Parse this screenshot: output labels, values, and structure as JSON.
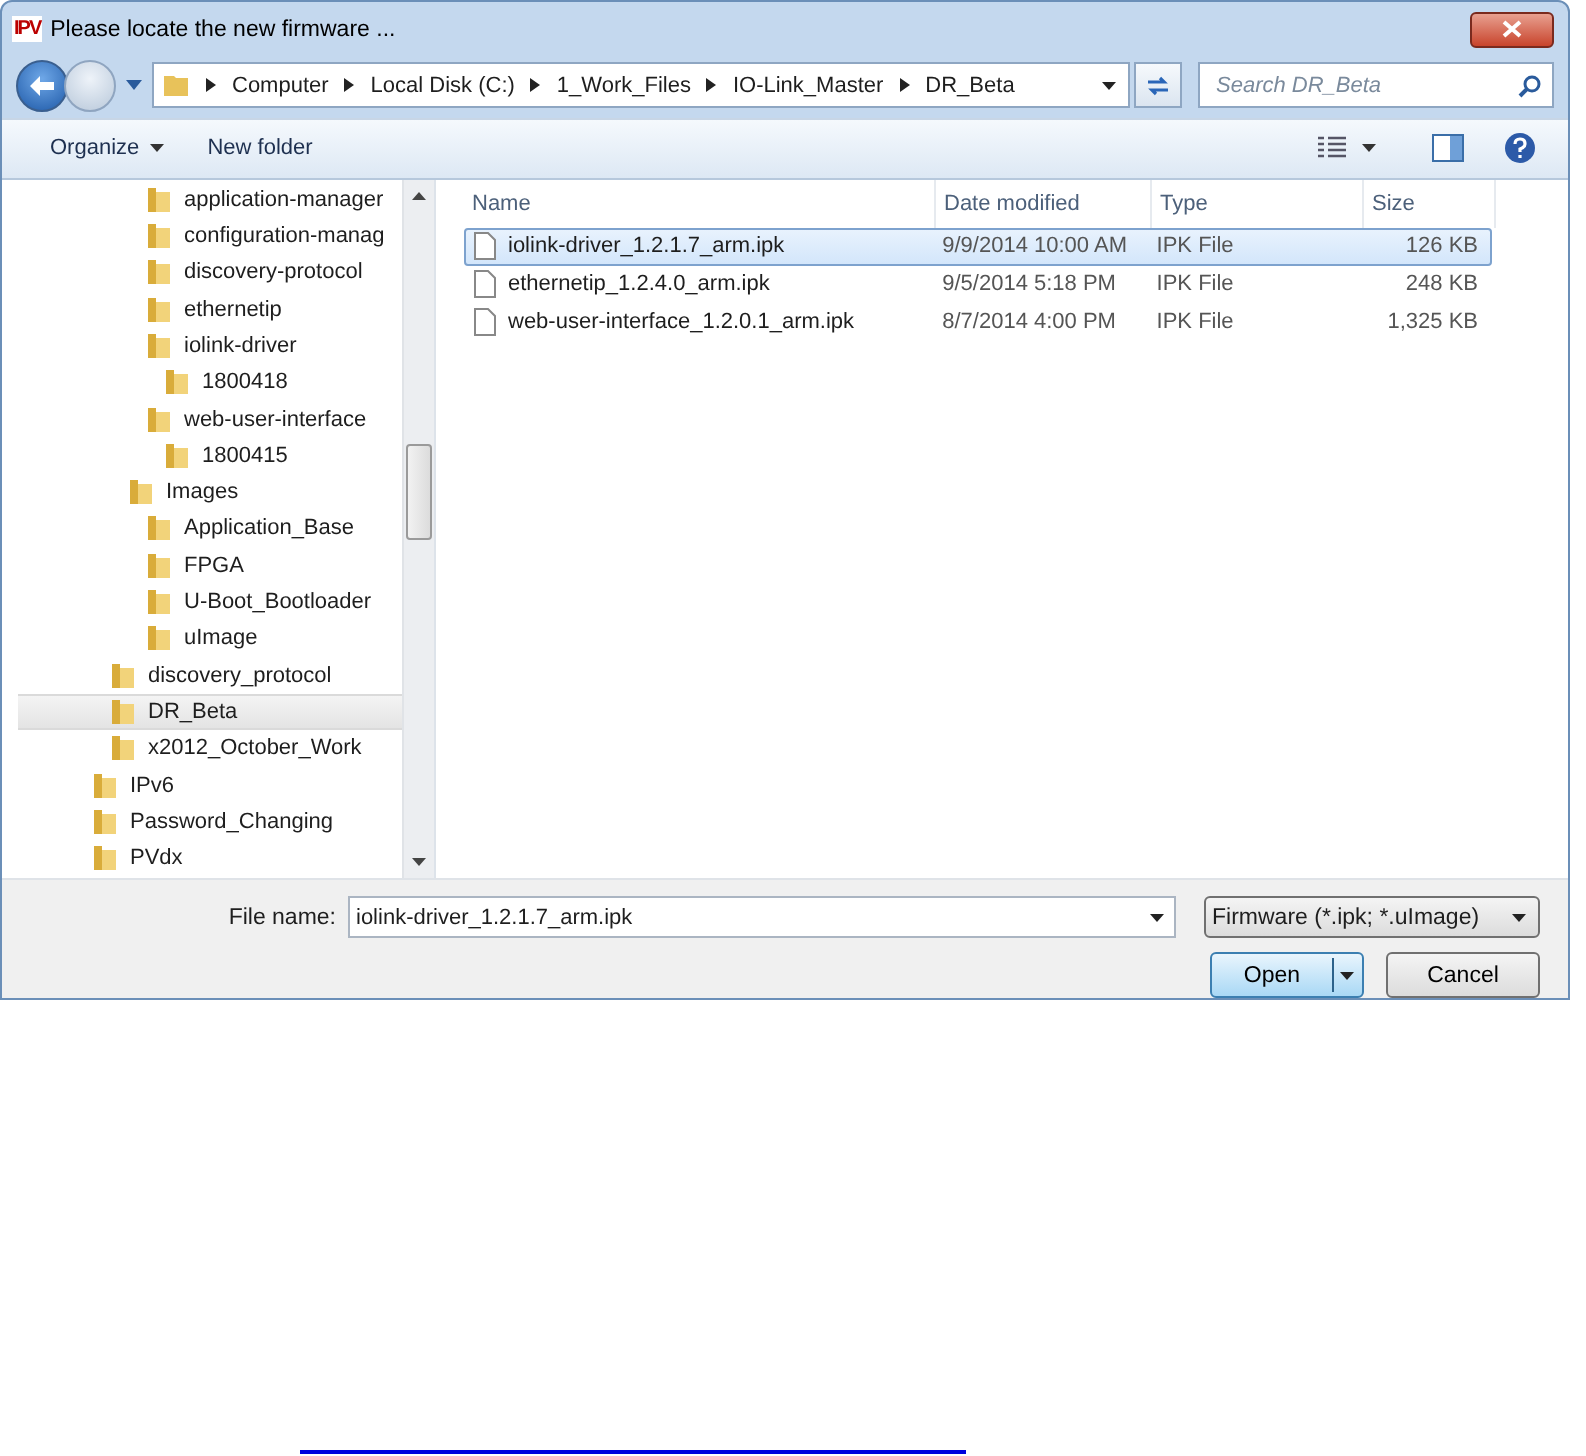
{
  "window": {
    "app_badge": "IPV",
    "title": "Please locate the new firmware ..."
  },
  "address": {
    "crumbs": [
      "Computer",
      "Local Disk (C:)",
      "1_Work_Files",
      "IO-Link_Master",
      "DR_Beta"
    ],
    "search_placeholder": "Search DR_Beta"
  },
  "toolbar": {
    "organize": "Organize",
    "new_folder": "New folder"
  },
  "tree": [
    {
      "children": [
        {
          "children": [
            {
              "children": [
                {
                  "label": "application-manager",
                  "selected": false
                },
                {
                  "label": "configuration-manag",
                  "selected": false
                },
                {
                  "label": "discovery-protocol",
                  "selected": false
                },
                {
                  "label": "ethernetip",
                  "selected": false
                },
                {
                  "label": "iolink-driver",
                  "selected": false,
                  "children": [
                    {
                      "label": "1800418",
                      "selected": false
                    }
                  ]
                },
                {
                  "label": "web-user-interface",
                  "selected": false,
                  "children": [
                    {
                      "label": "1800415",
                      "selected": false
                    }
                  ]
                }
              ]
            },
            {
              "label": "Images",
              "selected": false,
              "children": [
                {
                  "label": "Application_Base",
                  "selected": false
                },
                {
                  "label": "FPGA",
                  "selected": false
                },
                {
                  "label": "U-Boot_Bootloader",
                  "selected": false
                },
                {
                  "label": "uImage",
                  "selected": false
                }
              ]
            }
          ]
        },
        {
          "label": "discovery_protocol",
          "selected": false
        },
        {
          "label": "DR_Beta",
          "selected": true
        },
        {
          "label": "x2012_October_Work",
          "selected": false
        }
      ]
    },
    {
      "label": "IPv6",
      "selected": false
    },
    {
      "label": "Password_Changing",
      "selected": false
    },
    {
      "label": "PVdx",
      "selected": false
    }
  ],
  "columns": [
    "Name",
    "Date modified",
    "Type",
    "Size"
  ],
  "files": [
    {
      "name": "iolink-driver_1.2.1.7_arm.ipk",
      "date": "9/9/2014 10:00 AM",
      "type": "IPK File",
      "size": "126 KB",
      "selected": true
    },
    {
      "name": "ethernetip_1.2.4.0_arm.ipk",
      "date": "9/5/2014 5:18 PM",
      "type": "IPK File",
      "size": "248 KB",
      "selected": false
    },
    {
      "name": "web-user-interface_1.2.0.1_arm.ipk",
      "date": "8/7/2014 4:00 PM",
      "type": "IPK File",
      "size": "1,325 KB",
      "selected": false
    }
  ],
  "footer": {
    "file_name_label": "File name:",
    "file_name": "iolink-driver_1.2.1.7_arm.ipk",
    "filter": "Firmware (*.ipk; *.uImage)",
    "open": "Open",
    "cancel": "Cancel"
  }
}
